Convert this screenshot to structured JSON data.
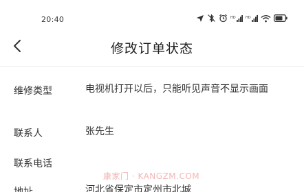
{
  "status_bar": {
    "time": "20:40",
    "icons": [
      "location-icon",
      "bluetooth-off-icon",
      "alarm-icon",
      "signal-hd-icon",
      "signal-hd-icon",
      "wifi-icon",
      "battery-icon"
    ]
  },
  "header": {
    "back_icon": "chevron-left-icon",
    "title": "修改订单状态"
  },
  "details": [
    {
      "label": "维修类型",
      "value": "电视机打开以后，只能听见声音不显示画面"
    },
    {
      "label": "联系人",
      "value": "张先生"
    },
    {
      "label": "联系电话",
      "value": ""
    },
    {
      "label": "地址",
      "value": "河北省保定市定州市北城"
    }
  ],
  "watermark": "康家门 · KANGZM.COM"
}
